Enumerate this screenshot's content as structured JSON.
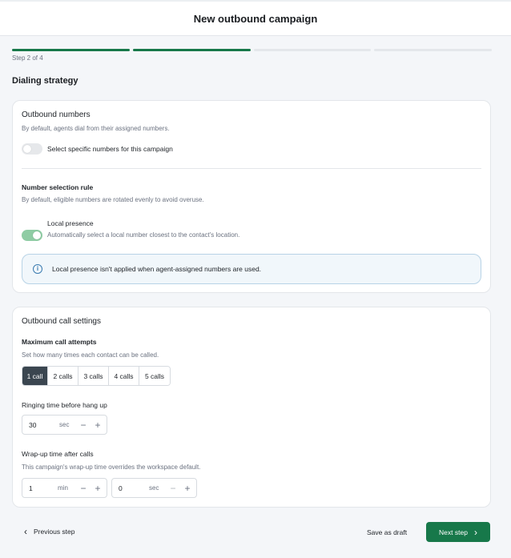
{
  "header": {
    "title": "New outbound campaign"
  },
  "progress": {
    "total_steps": 4,
    "completed_steps": 2,
    "label": "Step 2 of 4"
  },
  "section": {
    "title": "Dialing strategy"
  },
  "outbound_numbers": {
    "title": "Outbound numbers",
    "description": "By default, agents dial from their assigned numbers.",
    "toggle_label": "Select specific numbers for this campaign",
    "toggle_on": false
  },
  "number_selection": {
    "title": "Number selection rule",
    "description": "By default, eligible numbers are rotated evenly to avoid overuse.",
    "local_presence_label": "Local presence",
    "local_presence_description": "Automatically select a local number closest to the contact's location.",
    "local_presence_on": true,
    "info_icon": "i",
    "info_text": "Local presence isn't applied when agent-assigned numbers are used."
  },
  "call_settings": {
    "title": "Outbound call settings",
    "max_attempts": {
      "title": "Maximum call attempts",
      "description": "Set how many times each contact can be called.",
      "options": [
        "1 call",
        "2 calls",
        "3 calls",
        "4 calls",
        "5 calls"
      ],
      "selected": "1 call"
    },
    "ringing": {
      "title": "Ringing time before hang up",
      "value": "30",
      "unit": "sec"
    },
    "wrapup": {
      "title": "Wrap-up time after calls",
      "description": "This campaign's wrap-up time overrides the workspace default.",
      "minutes_value": "1",
      "minutes_unit": "min",
      "seconds_value": "0",
      "seconds_unit": "sec"
    },
    "minus_symbol": "−",
    "plus_symbol": "+"
  },
  "footer": {
    "previous_label": "Previous step",
    "previous_icon": "‹",
    "save_draft_label": "Save as draft",
    "next_label": "Next step",
    "next_icon": "›"
  },
  "colors": {
    "primary": "#17784a",
    "toggle_on": "#8fcca4",
    "info_border": "#b8d3e6",
    "selected_segment": "#3b4650"
  }
}
